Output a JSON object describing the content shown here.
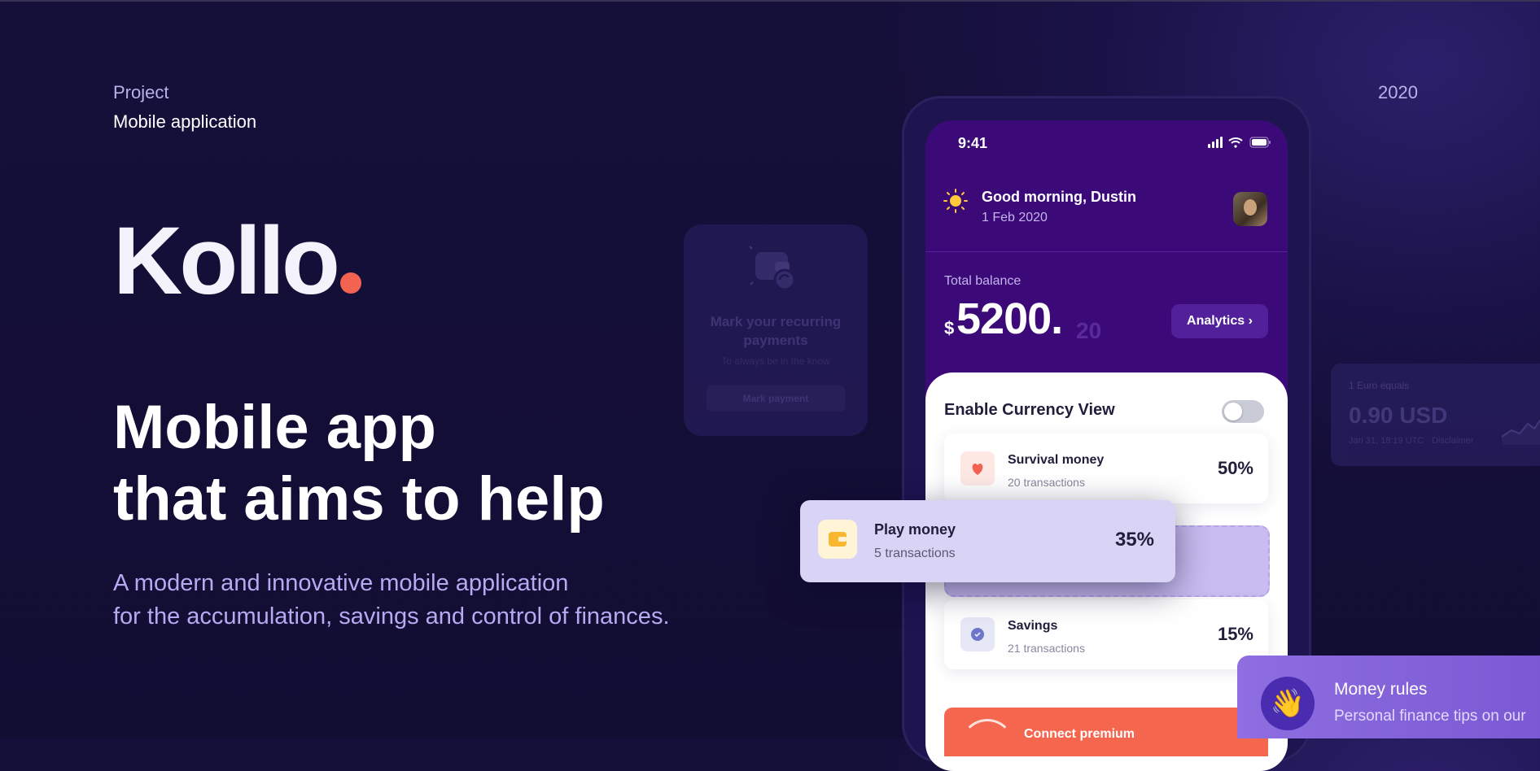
{
  "project": {
    "label": "Project",
    "value": "Mobile application",
    "year": "2020"
  },
  "brand": {
    "name": "Kollo",
    "dot_color": "#f26451"
  },
  "hero": {
    "headline_line1": "Mobile app",
    "headline_line2": "that aims to help",
    "sub_line1": "A modern and innovative mobile application",
    "sub_line2": "for the accumulation, savings and control of finances."
  },
  "recurring_card": {
    "title": "Mark your recurring payments",
    "subtitle": "To always be in the know",
    "button": "Mark payment"
  },
  "euro_card": {
    "line1": "1 Euro equals",
    "value": "0.90 USD",
    "meta": "Jan 31, 18:19 UTC · Disclaimer"
  },
  "phone": {
    "status_time": "9:41",
    "greeting": "Good morning, Dustin",
    "date": "1 Feb 2020",
    "balance_label": "Total balance",
    "balance_currency": "$",
    "balance_amount": "5200.",
    "balance_cents": "20",
    "analytics_label": "Analytics",
    "currency_view_label": "Enable Currency View",
    "currency_view_enabled": false,
    "categories": [
      {
        "name": "Survival money",
        "count": "20 transactions",
        "percent": "50%",
        "icon": "heart-icon",
        "color": "#f26451"
      },
      {
        "name": "Savings",
        "count": "21 transactions",
        "percent": "15%",
        "icon": "badge-icon",
        "color": "#6d76c9"
      }
    ],
    "premium_label": "Connect premium"
  },
  "play_card": {
    "name": "Play money",
    "count": "5 transactions",
    "percent": "35%",
    "icon": "wallet-icon"
  },
  "rules_card": {
    "title": "Money rules",
    "subtitle": "Personal finance tips on our",
    "icon": "waving-hand-icon",
    "emoji": "👋"
  }
}
